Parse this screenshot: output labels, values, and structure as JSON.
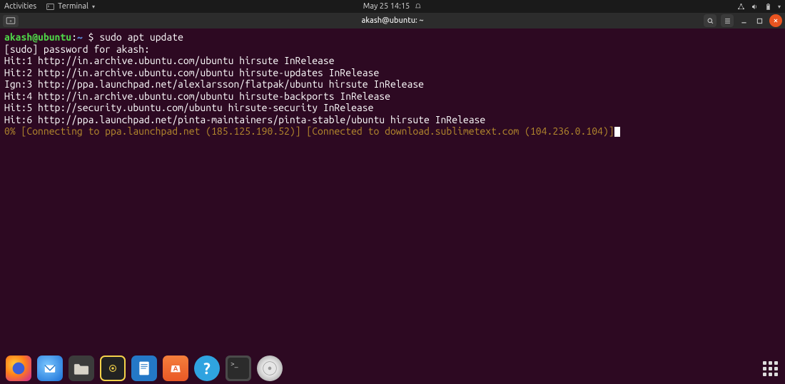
{
  "topbar": {
    "activities": "Activities",
    "app_name": "Terminal",
    "datetime": "May 25  14:15"
  },
  "window": {
    "title": "akash@ubuntu: ~"
  },
  "terminal": {
    "prompt_user": "akash@ubuntu",
    "prompt_sep": ":",
    "prompt_path": "~",
    "prompt_symbol": "$",
    "command": "sudo apt update",
    "lines": [
      "[sudo] password for akash:",
      "Hit:1 http://in.archive.ubuntu.com/ubuntu hirsute InRelease",
      "Hit:2 http://in.archive.ubuntu.com/ubuntu hirsute-updates InRelease",
      "Ign:3 http://ppa.launchpad.net/alexlarsson/flatpak/ubuntu hirsute InRelease",
      "Hit:4 http://in.archive.ubuntu.com/ubuntu hirsute-backports InRelease",
      "Hit:5 http://security.ubuntu.com/ubuntu hirsute-security InRelease",
      "Hit:6 http://ppa.launchpad.net/pinta-maintainers/pinta-stable/ubuntu hirsute InRelease"
    ],
    "progress_line": "0% [Connecting to ppa.launchpad.net (185.125.190.52)] [Connected to download.sublimetext.com (104.236.0.104)]"
  },
  "dock": {
    "items": [
      {
        "name": "firefox",
        "label": "Firefox"
      },
      {
        "name": "thunderbird",
        "label": "Thunderbird"
      },
      {
        "name": "files",
        "label": "Files"
      },
      {
        "name": "rhythmbox",
        "label": "Rhythmbox"
      },
      {
        "name": "writer",
        "label": "LibreOffice Writer"
      },
      {
        "name": "software",
        "label": "Ubuntu Software"
      },
      {
        "name": "help",
        "label": "Help"
      },
      {
        "name": "terminal",
        "label": "Terminal"
      },
      {
        "name": "disk",
        "label": "Removable Disk"
      }
    ]
  }
}
